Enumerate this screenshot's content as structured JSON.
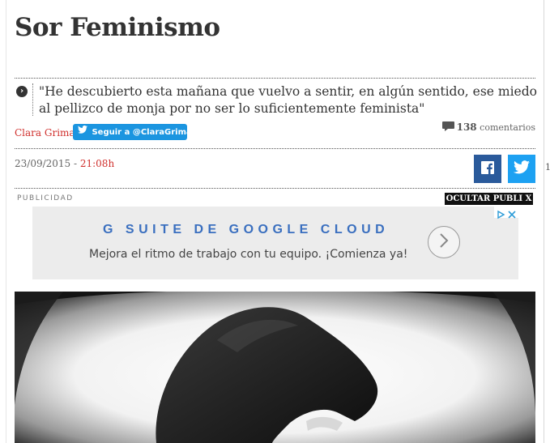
{
  "article": {
    "title": "Sor Feminismo",
    "quote": "\"He descubierto esta mañana que vuelvo a sentir, en algún sentido, ese miedo al pellizco de monja por no ser lo suficientemente feminista\"",
    "author": "Clara Grima",
    "follow_label": "Seguir a @ClaraGrima",
    "comments_count": "138",
    "comments_label": "comentarios",
    "date": "23/09/2015",
    "date_separator": " - ",
    "time": "21:08h"
  },
  "share": {
    "facebook_icon": "facebook-icon",
    "twitter_icon": "twitter-icon"
  },
  "ads": {
    "label": "PUBLICIDAD",
    "hide_label": "OCULTAR PUBLI X",
    "headline": "G SUITE DE GOOGLE CLOUD",
    "subtext": "Mejora el ritmo de trabajo con tu equipo. ¡Comienza ya!"
  },
  "edge_text": "1",
  "colors": {
    "accent_red": "#d0302d",
    "twitter_blue": "#1da1f2",
    "facebook_blue": "#2a5a9b",
    "ad_blue": "#3a6fbf"
  }
}
